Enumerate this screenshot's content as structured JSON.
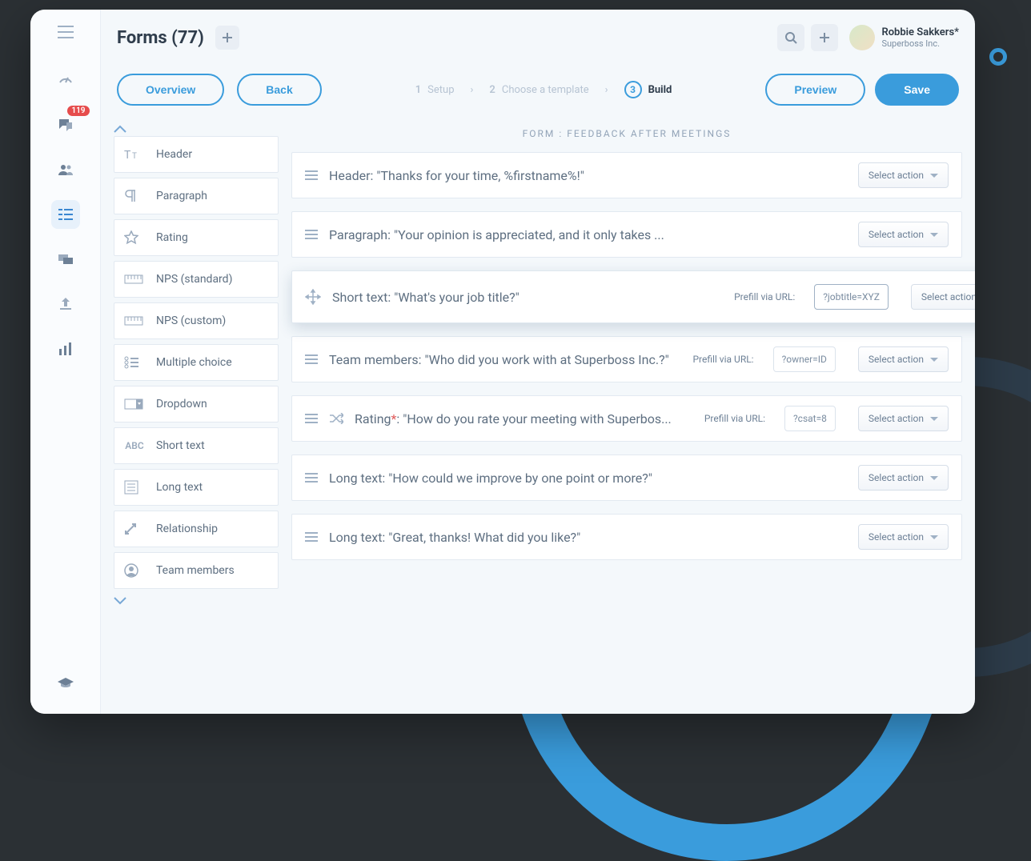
{
  "header": {
    "title": "Forms (77)",
    "user_name": "Robbie Sakkers*",
    "user_company": "Superboss Inc.",
    "notif_count": "119"
  },
  "actions": {
    "overview": "Overview",
    "back": "Back",
    "preview": "Preview",
    "save": "Save"
  },
  "steps": {
    "s1_num": "1",
    "s1_label": "Setup",
    "s2_num": "2",
    "s2_label": "Choose a template",
    "s3_num": "3",
    "s3_label": "Build"
  },
  "canvas": {
    "heading": "FORM : FEEDBACK AFTER MEETINGS",
    "select_action": "Select action",
    "rows": [
      {
        "type": "Header:",
        "text": "\"Thanks for your time, %firstname%!\""
      },
      {
        "type": "Paragraph:",
        "text": "\"Your opinion is appreciated, and it only takes ..."
      },
      {
        "type": "Short text:",
        "text": "\"What's your job title?\"",
        "prefill_label": "Prefill via URL:",
        "prefill": "?jobtitle=XYZ",
        "active": true
      },
      {
        "type": "Team members:",
        "text": "\"Who did you work with at Superboss Inc.?\"",
        "prefill_label": "Prefill via URL:",
        "prefill": "?owner=ID"
      },
      {
        "type": "Rating",
        "req": "*",
        "suffix": ":",
        "text": "\"How do you rate your meeting with Superbos...",
        "prefill_label": "Prefill via URL:",
        "prefill": "?csat=8",
        "shuffle": true
      },
      {
        "type": "Long text:",
        "text": "\"How could we improve by one point or more?\""
      },
      {
        "type": "Long text:",
        "text": "\"Great, thanks! What did you like?\""
      }
    ]
  },
  "palette": {
    "items": [
      {
        "label": "Header",
        "icon": "tt"
      },
      {
        "label": "Paragraph",
        "icon": "pilcrow"
      },
      {
        "label": "Rating",
        "icon": "star"
      },
      {
        "label": "NPS (standard)",
        "icon": "ruler"
      },
      {
        "label": "NPS (custom)",
        "icon": "ruler"
      },
      {
        "label": "Multiple choice",
        "icon": "checklist"
      },
      {
        "label": "Dropdown",
        "icon": "dropdown"
      },
      {
        "label": "Short text",
        "icon": "abc"
      },
      {
        "label": "Long text",
        "icon": "lines"
      },
      {
        "label": "Relationship",
        "icon": "link"
      },
      {
        "label": "Team members",
        "icon": "person"
      }
    ]
  }
}
